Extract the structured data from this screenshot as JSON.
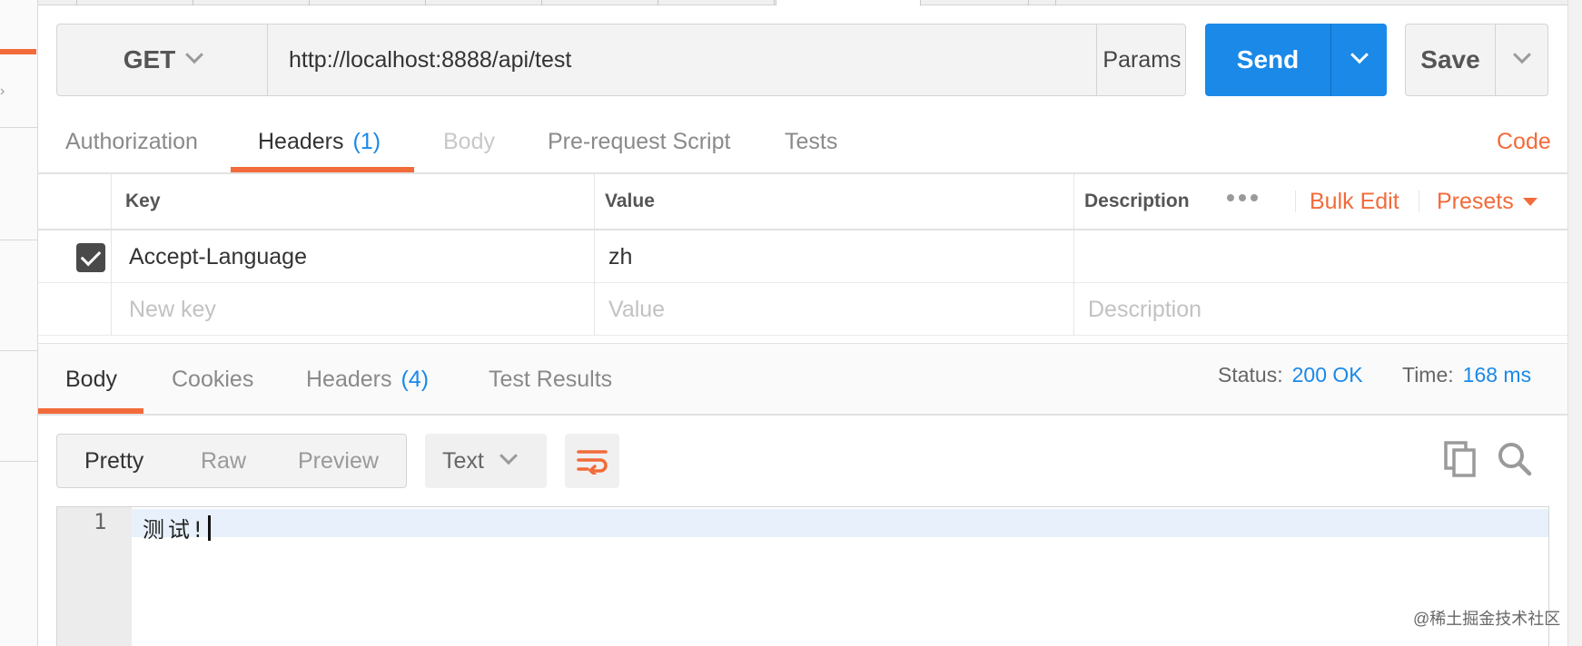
{
  "request": {
    "method": "GET",
    "url": "http://localhost:8888/api/test",
    "params_label": "Params",
    "send_label": "Send",
    "save_label": "Save"
  },
  "request_tabs": [
    {
      "label": "Authorization"
    },
    {
      "label": "Headers",
      "count": "(1)"
    },
    {
      "label": "Body"
    },
    {
      "label": "Pre-request Script"
    },
    {
      "label": "Tests"
    }
  ],
  "code_label": "Code",
  "headers_table": {
    "columns": [
      "Key",
      "Value",
      "Description"
    ],
    "bulk_edit_label": "Bulk Edit",
    "presets_label": "Presets",
    "rows": [
      {
        "key": "Accept-Language",
        "value": "zh",
        "description": "",
        "checked": true
      }
    ],
    "placeholders": {
      "key": "New key",
      "value": "Value",
      "description": "Description"
    }
  },
  "response_tabs": [
    {
      "label": "Body"
    },
    {
      "label": "Cookies"
    },
    {
      "label": "Headers",
      "count": "(4)"
    },
    {
      "label": "Test Results"
    }
  ],
  "status": {
    "label": "Status:",
    "value": "200 OK",
    "time_label": "Time:",
    "time_value": "168 ms"
  },
  "view_modes": [
    "Pretty",
    "Raw",
    "Preview"
  ],
  "format": "Text",
  "editor": {
    "line_number": "1",
    "line_text": "测试!"
  },
  "watermark": "@稀土掘金技术社区",
  "colors": {
    "accent": "#f26b3a",
    "primary": "#1a89e8"
  }
}
